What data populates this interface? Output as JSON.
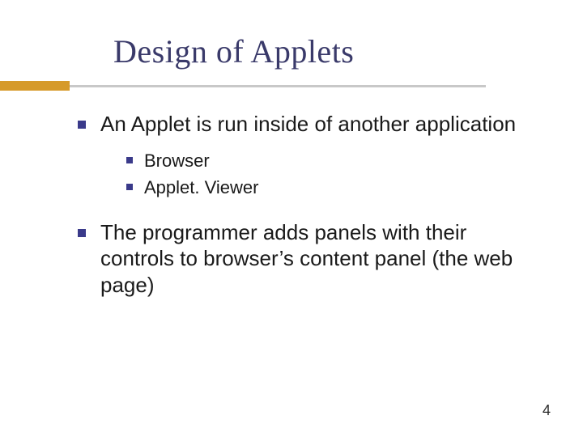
{
  "title": "Design of Applets",
  "bullets": {
    "b1": "An Applet is run inside of another application",
    "b1_sub": {
      "s1": "Browser",
      "s2": "Applet. Viewer"
    },
    "b2": "The programmer adds panels with their controls to browser’s content panel (the web page)"
  },
  "page_number": "4"
}
